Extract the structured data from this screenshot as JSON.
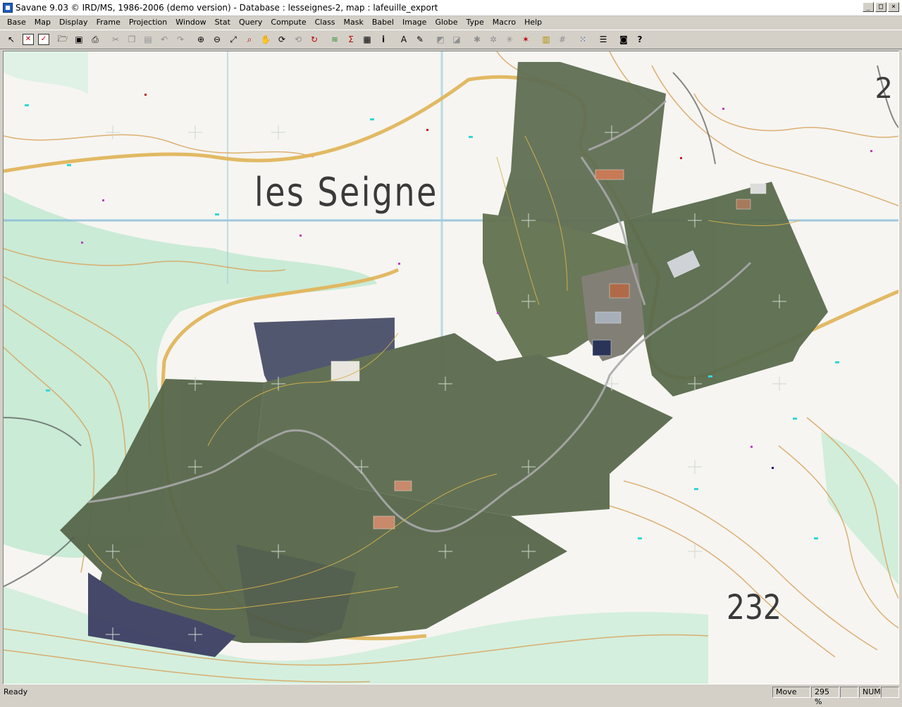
{
  "window": {
    "title": "Savane 9.03 © IRD/MS, 1986-2006 (demo version)  - Database : lesseignes-2, map : lafeuille_export",
    "minimize": "_",
    "maximize": "□",
    "close": "×"
  },
  "menu": {
    "items": [
      "Base",
      "Map",
      "Display",
      "Frame",
      "Projection",
      "Window",
      "Stat",
      "Query",
      "Compute",
      "Class",
      "Mask",
      "Babel",
      "Image",
      "Globe",
      "Type",
      "Macro",
      "Help"
    ]
  },
  "toolbar": {
    "buttons": [
      {
        "icon": "select-arrow-icon",
        "glyph": "↖"
      },
      {
        "icon": "delete-icon",
        "glyph": "✕"
      },
      {
        "icon": "validate-icon",
        "glyph": "✓"
      },
      {
        "icon": "open-folder-icon",
        "glyph": "🗁"
      },
      {
        "icon": "save-icon",
        "glyph": "▣"
      },
      {
        "icon": "print-icon",
        "glyph": "⎙"
      },
      {
        "icon": "cut-icon",
        "glyph": "✂"
      },
      {
        "icon": "copy-icon",
        "glyph": "❐"
      },
      {
        "icon": "paste-icon",
        "glyph": "▤"
      },
      {
        "icon": "undo-icon",
        "glyph": "↶"
      },
      {
        "icon": "redo-icon",
        "glyph": "↷"
      },
      {
        "icon": "zoom-in-icon",
        "glyph": "⊕"
      },
      {
        "icon": "zoom-out-icon",
        "glyph": "⊖"
      },
      {
        "icon": "zoom-window-icon",
        "glyph": "⤢"
      },
      {
        "icon": "zoom-object-icon",
        "glyph": "⌕"
      },
      {
        "icon": "pan-hand-icon",
        "glyph": "✋"
      },
      {
        "icon": "rotate-icon",
        "glyph": "⟳"
      },
      {
        "icon": "previous-view-icon",
        "glyph": "⟲"
      },
      {
        "icon": "refresh-icon",
        "glyph": "↻"
      },
      {
        "icon": "layers-icon",
        "glyph": "≋"
      },
      {
        "icon": "sum-icon",
        "glyph": "Σ"
      },
      {
        "icon": "table-icon",
        "glyph": "▦"
      },
      {
        "icon": "info-icon",
        "glyph": "i"
      },
      {
        "icon": "text-icon",
        "glyph": "A"
      },
      {
        "icon": "pencil-icon",
        "glyph": "✎"
      },
      {
        "icon": "shape-icon",
        "glyph": "◩"
      },
      {
        "icon": "shape2-icon",
        "glyph": "◪"
      },
      {
        "icon": "network-icon",
        "glyph": "✱"
      },
      {
        "icon": "network2-icon",
        "glyph": "✲"
      },
      {
        "icon": "network3-icon",
        "glyph": "✳"
      },
      {
        "icon": "network-delete-icon",
        "glyph": "✶"
      },
      {
        "icon": "legend-icon",
        "glyph": "▥"
      },
      {
        "icon": "grid-icon",
        "glyph": "#"
      },
      {
        "icon": "dots-grid-icon",
        "glyph": "⁙"
      },
      {
        "icon": "list-icon",
        "glyph": "☰"
      },
      {
        "icon": "camera-icon",
        "glyph": "◙"
      },
      {
        "icon": "help-cursor-icon",
        "glyph": "?"
      }
    ]
  },
  "map": {
    "place_name": "les Seigne",
    "elevation_label": "232",
    "edge_label": "2"
  },
  "status": {
    "text": "Ready",
    "mode": "Move",
    "zoom": "295 %",
    "num": "NUM"
  }
}
